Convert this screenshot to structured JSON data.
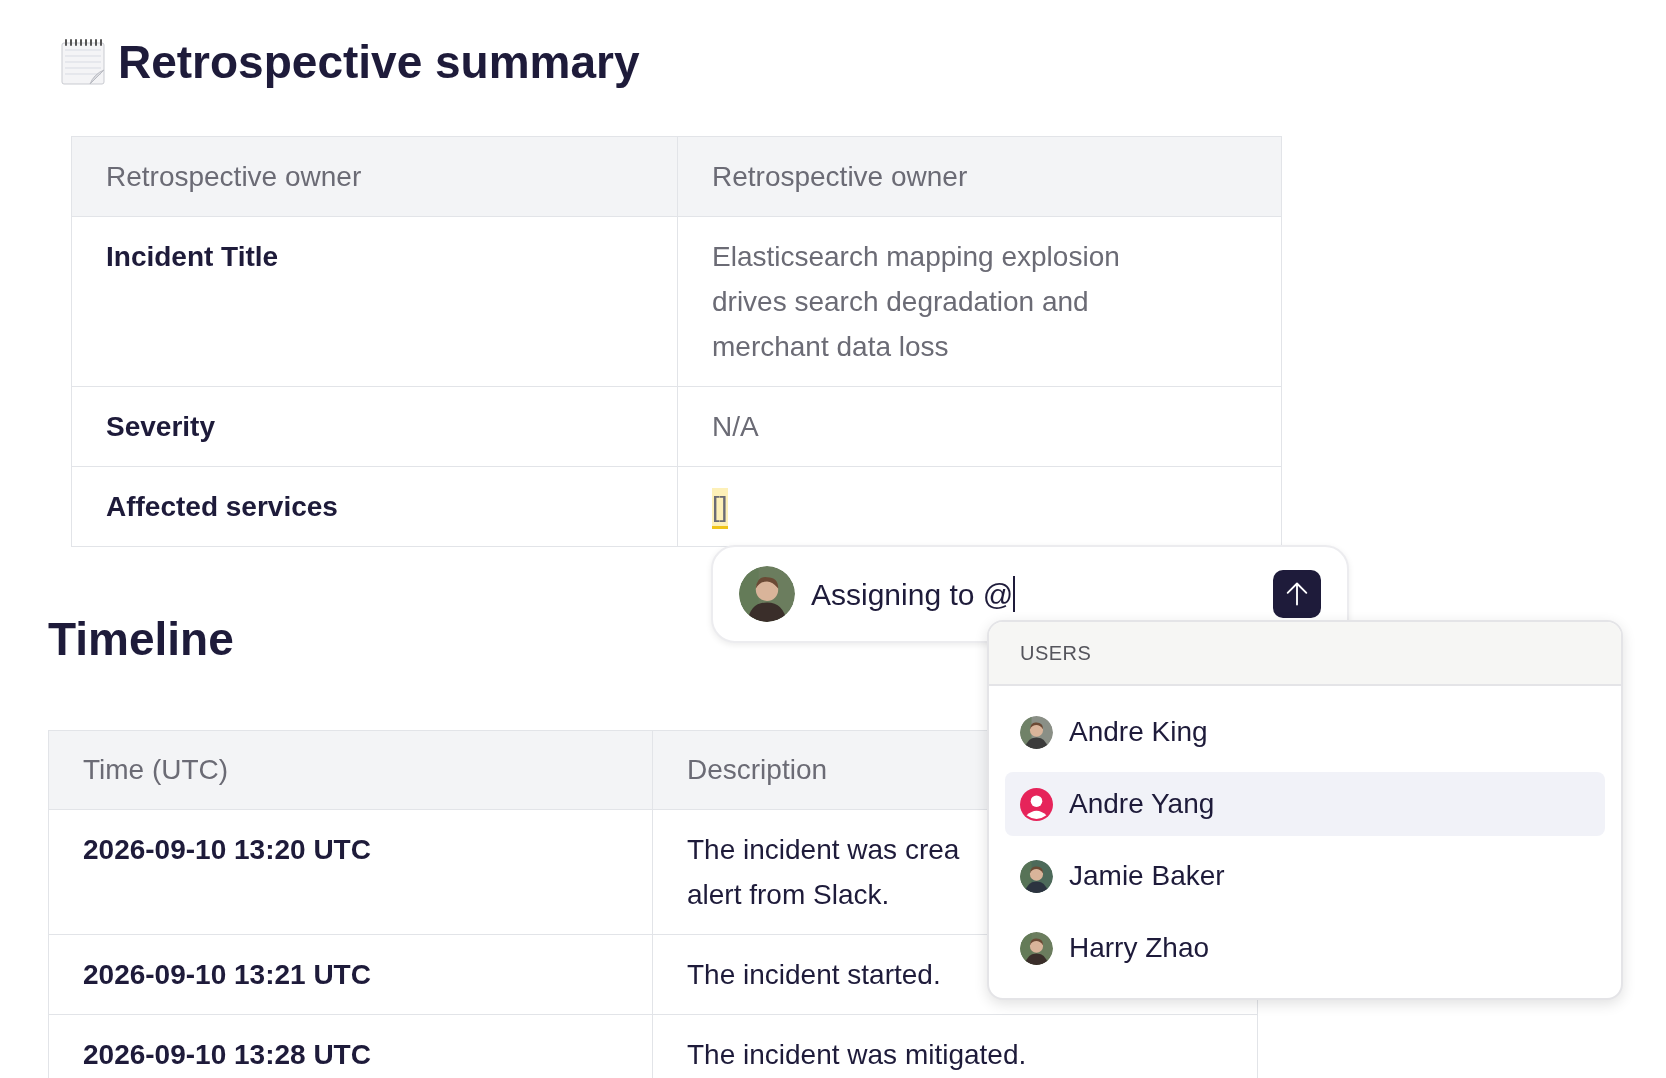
{
  "page_title": "Retrospective summary",
  "summary_table": {
    "columns": [
      "Retrospective owner",
      "Retrospective owner"
    ],
    "rows": [
      {
        "label": "Incident Title",
        "value": "Elasticsearch mapping explosion drives search degradation and merchant data loss",
        "highlighted": false
      },
      {
        "label": "Severity",
        "value": "N/A",
        "highlighted": false
      },
      {
        "label": "Affected services",
        "value": "[]",
        "highlighted": true
      }
    ]
  },
  "timeline": {
    "heading": "Timeline",
    "columns": [
      "Time (UTC)",
      "Description"
    ],
    "rows": [
      {
        "time": "2026-09-10 13:20 UTC",
        "description": [
          "The incident was crea",
          "alert from Slack."
        ]
      },
      {
        "time": "2026-09-10 13:21 UTC",
        "description": [
          "The incident started."
        ]
      },
      {
        "time": "2026-09-10 13:28 UTC",
        "description": [
          "The incident was mitigated."
        ]
      }
    ]
  },
  "composer": {
    "text": "Assigning to @",
    "focused": true
  },
  "mention_menu": {
    "section": "USERS",
    "users": [
      {
        "name": "Andre King",
        "selected": false
      },
      {
        "name": "Andre Yang",
        "kind": "placeholder",
        "selected": true
      },
      {
        "name": "Jamie Baker",
        "selected": false
      },
      {
        "name": "Harry Zhao",
        "selected": false
      }
    ]
  }
}
